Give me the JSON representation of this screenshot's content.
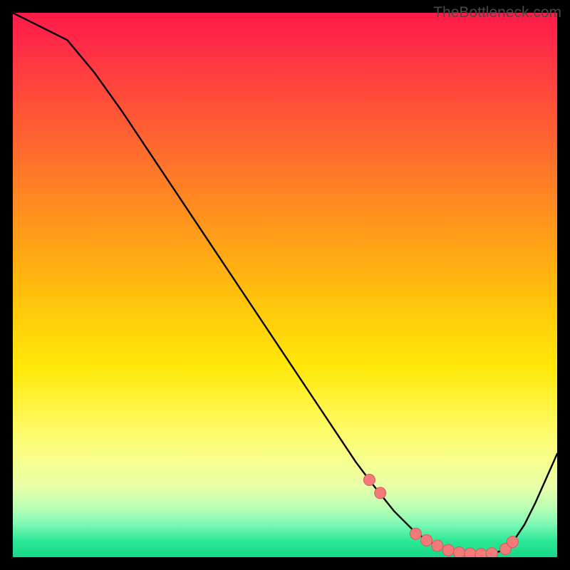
{
  "watermark": "TheBottleneck.com",
  "chart_data": {
    "type": "line",
    "title": "",
    "xlabel": "",
    "ylabel": "",
    "xlim": [
      0,
      100
    ],
    "ylim": [
      0,
      100
    ],
    "curve": {
      "x": [
        0,
        4,
        7,
        10,
        15,
        20,
        25,
        30,
        35,
        40,
        45,
        50,
        55,
        60,
        63,
        66,
        70,
        74,
        78,
        82,
        86,
        88,
        90,
        92,
        94,
        96,
        98,
        100
      ],
      "y": [
        100,
        98,
        96.5,
        95,
        89,
        82,
        74.5,
        67,
        59.5,
        52,
        44.5,
        37,
        29.5,
        22,
        17.5,
        13.5,
        8.5,
        4.5,
        2,
        0.8,
        0.5,
        0.7,
        1.2,
        3,
        6,
        10,
        14.5,
        19
      ]
    },
    "markers": {
      "x": [
        65.5,
        67.5,
        74,
        76,
        78,
        80,
        82,
        84,
        86,
        88,
        90.5,
        91.8
      ],
      "y": [
        14.2,
        11.8,
        4.3,
        3.1,
        2.1,
        1.3,
        0.85,
        0.65,
        0.55,
        0.7,
        1.5,
        2.8
      ]
    },
    "marker_style": {
      "fill": "#f27a78",
      "stroke": "#d85a58",
      "r": 8
    }
  }
}
